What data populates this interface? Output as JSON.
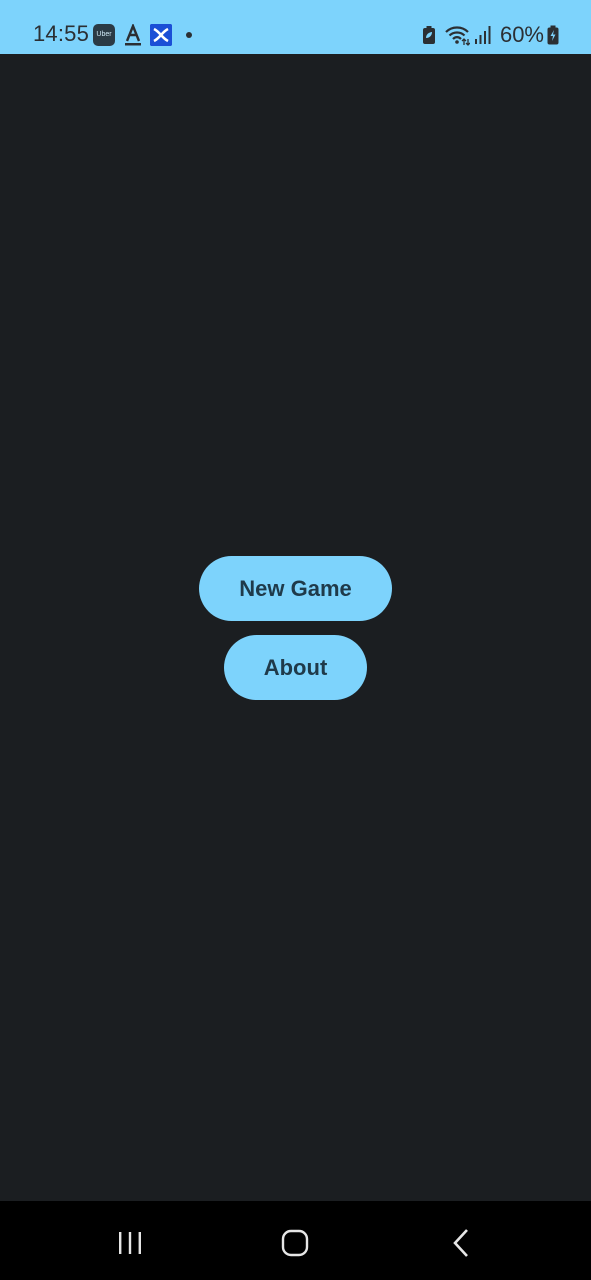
{
  "status_bar": {
    "time": "14:55",
    "uber_label": "Uber",
    "battery_percent": "60%",
    "background_color": "#7dd3fc",
    "icons": [
      "uber-icon",
      "font-a-icon",
      "cross-app-icon",
      "dot-icon",
      "battery-saver-icon",
      "wifi-icon",
      "signal-icon",
      "battery-icon"
    ]
  },
  "menu": {
    "new_game_label": "New Game",
    "about_label": "About",
    "button_color": "#7dd3fc",
    "background_color": "#1b1e21"
  },
  "nav_bar": {
    "icons": [
      "recents-icon",
      "home-icon",
      "back-icon"
    ]
  }
}
